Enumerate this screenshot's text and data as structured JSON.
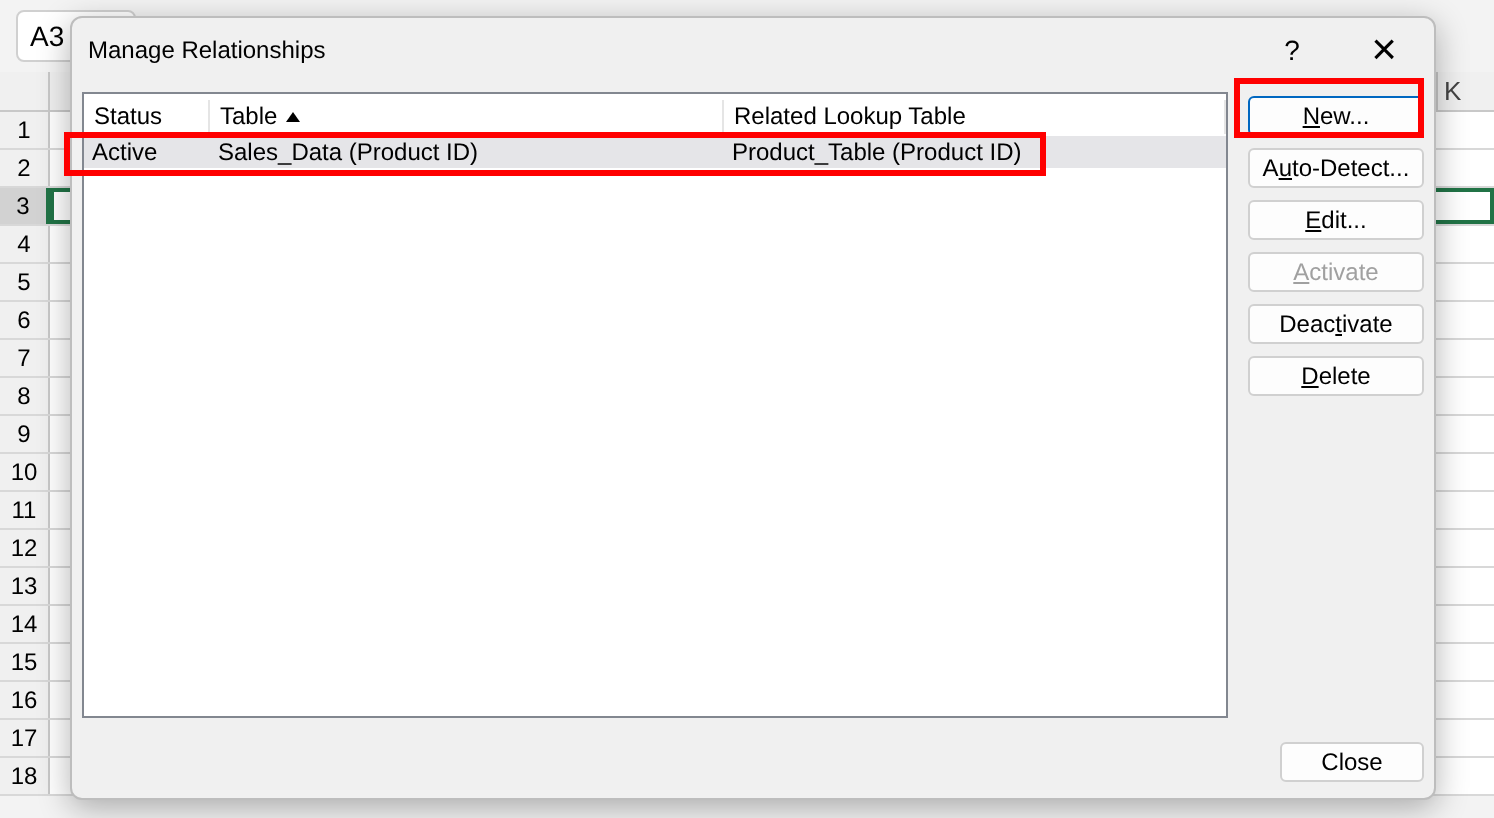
{
  "sheet": {
    "name_box": "A3",
    "column_header": "K",
    "rows": [
      {
        "label": "1",
        "selected": false
      },
      {
        "label": "2",
        "selected": false
      },
      {
        "label": "3",
        "selected": true
      },
      {
        "label": "4",
        "selected": false
      },
      {
        "label": "5",
        "selected": false
      },
      {
        "label": "6",
        "selected": false
      },
      {
        "label": "7",
        "selected": false
      },
      {
        "label": "8",
        "selected": false
      },
      {
        "label": "9",
        "selected": false
      },
      {
        "label": "10",
        "selected": false
      },
      {
        "label": "11",
        "selected": false
      },
      {
        "label": "12",
        "selected": false
      },
      {
        "label": "13",
        "selected": false
      },
      {
        "label": "14",
        "selected": false
      },
      {
        "label": "15",
        "selected": false
      },
      {
        "label": "16",
        "selected": false
      },
      {
        "label": "17",
        "selected": false
      },
      {
        "label": "18",
        "selected": false
      }
    ]
  },
  "dialog": {
    "title": "Manage Relationships",
    "help": "?",
    "close": "×",
    "table": {
      "columns": [
        {
          "label": "Status",
          "sorted": false
        },
        {
          "label": "Table",
          "sorted": true
        },
        {
          "label": "Related Lookup Table",
          "sorted": false
        }
      ],
      "rows": [
        {
          "cells": [
            "Active",
            "Sales_Data (Product ID)",
            "Product_Table (Product ID)"
          ],
          "selected": true,
          "highlighted": true
        }
      ]
    },
    "buttons": [
      {
        "key": "N",
        "after": "ew...",
        "disabled": false,
        "highlighted": true,
        "focused": true
      },
      {
        "before": "A",
        "key": "u",
        "after": "to-Detect...",
        "disabled": false,
        "highlighted": false,
        "focused": false
      },
      {
        "key": "E",
        "after": "dit...",
        "disabled": false,
        "highlighted": false,
        "focused": false
      },
      {
        "key": "A",
        "after": "ctivate",
        "disabled": true,
        "highlighted": false,
        "focused": false
      },
      {
        "before": "Deac",
        "key": "t",
        "after": "ivate",
        "disabled": false,
        "highlighted": false,
        "focused": false
      },
      {
        "key": "D",
        "after": "elete",
        "disabled": false,
        "highlighted": false,
        "focused": false
      }
    ],
    "close_button": "Close"
  }
}
